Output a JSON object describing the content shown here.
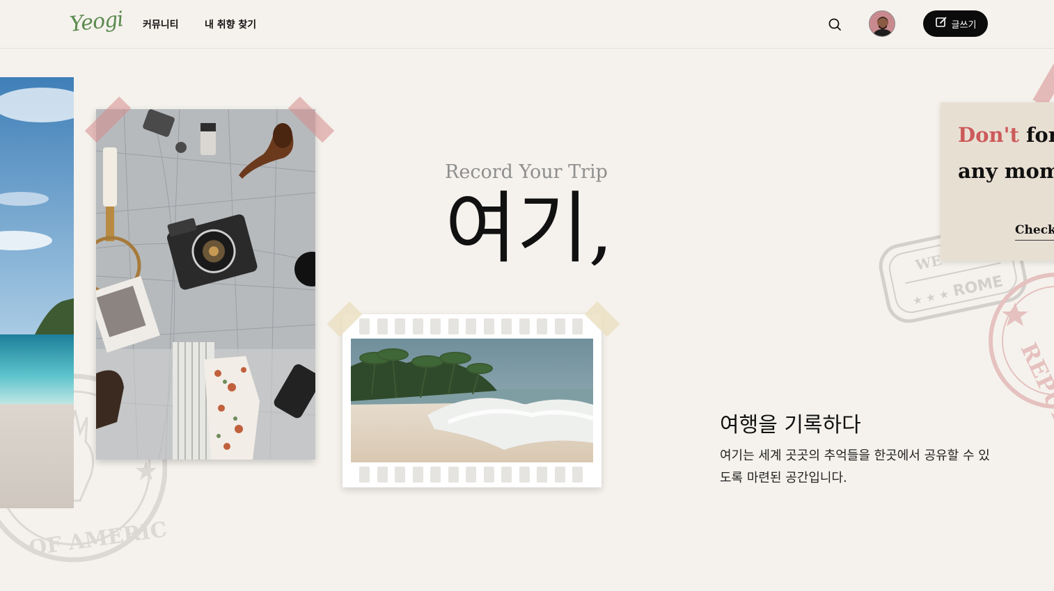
{
  "header": {
    "logo": "Yeogi",
    "nav": [
      "커뮤니티",
      "내 취향 찾기"
    ],
    "write_label": "글쓰기",
    "icons": {
      "search": "search-icon",
      "write": "edit-icon"
    }
  },
  "hero": {
    "subtitle": "Record Your Trip",
    "title": "여기,"
  },
  "note": {
    "accent": "Don't",
    "line1_rest": " forg",
    "line2": "any mome",
    "link": "Check"
  },
  "description": {
    "title": "여행을 기록하다",
    "body": "여기는 세계 곳곳의 추억들을 한곳에서 공유할 수 있도록 마련된 공간입니다."
  },
  "stamps": {
    "left": "OF AMERICA",
    "right": "ROME",
    "right_top": "WE",
    "right_side": "REPUBL"
  },
  "colors": {
    "background": "#f5f2ed",
    "accent_red": "#cc5a5a",
    "button": "#0b0b0b",
    "logo": "#5a8a4e"
  }
}
